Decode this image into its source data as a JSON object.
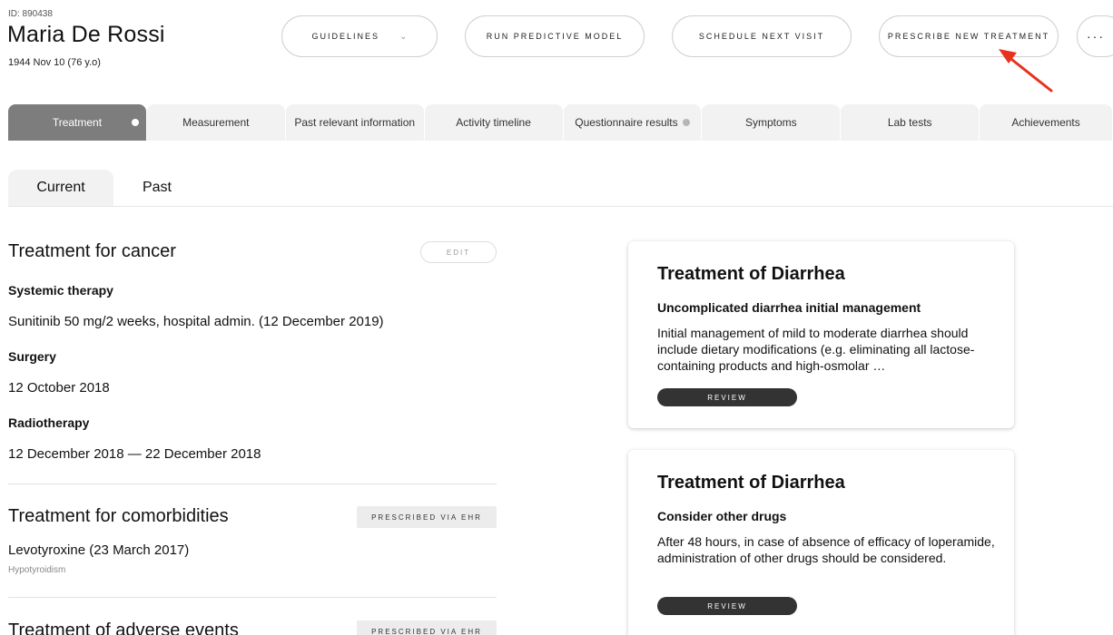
{
  "patient": {
    "id": "ID: 890438",
    "name": "Maria De Rossi",
    "dob": "1944 Nov 10 (76 y.o)"
  },
  "header_buttons": {
    "guidelines": "GUIDELINES",
    "run_model": "RUN PREDICTIVE MODEL",
    "schedule": "SCHEDULE NEXT VISIT",
    "prescribe": "PRESCRIBE NEW TREATMENT",
    "more": "···"
  },
  "tabs": [
    {
      "label": "Treatment"
    },
    {
      "label": "Measurement"
    },
    {
      "label": "Past relevant information"
    },
    {
      "label": "Activity timeline"
    },
    {
      "label": "Questionnaire results"
    },
    {
      "label": "Symptoms"
    },
    {
      "label": "Lab tests"
    },
    {
      "label": "Achievements"
    }
  ],
  "subtabs": {
    "current": "Current",
    "past": "Past"
  },
  "cancer": {
    "title": "Treatment for cancer",
    "edit": "EDIT",
    "systemic_label": "Systemic therapy",
    "systemic_value": "Sunitinib 50 mg/2 weeks, hospital admin. (12 December 2019)",
    "surgery_label": "Surgery",
    "surgery_value": "12 October 2018",
    "radio_label": "Radiotherapy",
    "radio_value": "12 December 2018 — 22 December 2018"
  },
  "comorbidities": {
    "title": "Treatment for comorbidities",
    "badge": "PRESCRIBED VIA EHR",
    "drug": "Levotyroxine (23 March 2017)",
    "condition": "Hypotyroidism"
  },
  "adverse": {
    "title": "Treatment of adverse events",
    "badge": "PRESCRIBED VIA EHR"
  },
  "cards": [
    {
      "title": "Treatment of Diarrhea",
      "subtitle": "Uncomplicated diarrhea initial management",
      "text": "Initial management of mild to moderate diarrhea should include dietary modifications (e.g. eliminating all lactose-containing products and high-osmolar …",
      "button": "REVIEW"
    },
    {
      "title": "Treatment of Diarrhea",
      "subtitle": "Consider other drugs",
      "text": "After 48 hours, in case of absence of efficacy of loperamide, administration of other drugs should be considered.",
      "button": "REVIEW"
    }
  ],
  "colors": {
    "active_tab": "#7d7d7d",
    "review_button": "#333333",
    "annotation_arrow": "#e8321e"
  }
}
